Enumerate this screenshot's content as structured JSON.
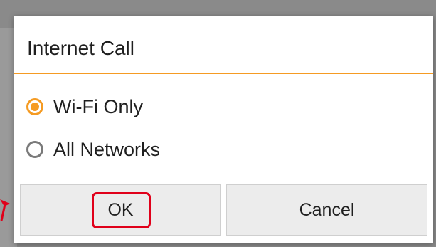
{
  "dialog": {
    "title": "Internet Call",
    "options": [
      {
        "label": "Wi-Fi Only",
        "selected": true
      },
      {
        "label": "All Networks",
        "selected": false
      }
    ],
    "buttons": {
      "ok_label": "OK",
      "cancel_label": "Cancel"
    }
  },
  "colors": {
    "accent": "#f59b23",
    "annotation": "#e0001a"
  }
}
